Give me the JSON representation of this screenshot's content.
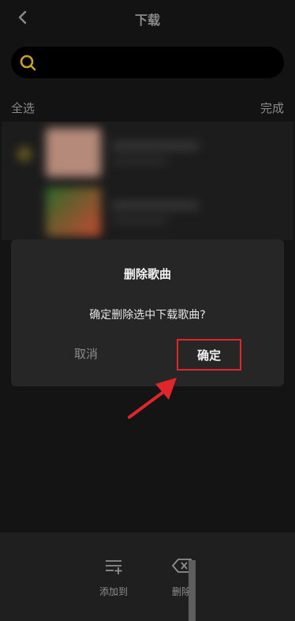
{
  "header": {
    "title": "下载"
  },
  "toolbar": {
    "select_all": "全选",
    "done": "完成"
  },
  "search": {
    "placeholder": ""
  },
  "dialog": {
    "title": "删除歌曲",
    "message": "确定删除选中下载歌曲?",
    "cancel": "取消",
    "confirm": "确定"
  },
  "bottom_bar": {
    "add_to": "添加到",
    "delete": "删除"
  },
  "colors": {
    "accent": "#c9a227",
    "highlight": "#e0252b",
    "background": "#131313",
    "dialog": "#262626"
  }
}
